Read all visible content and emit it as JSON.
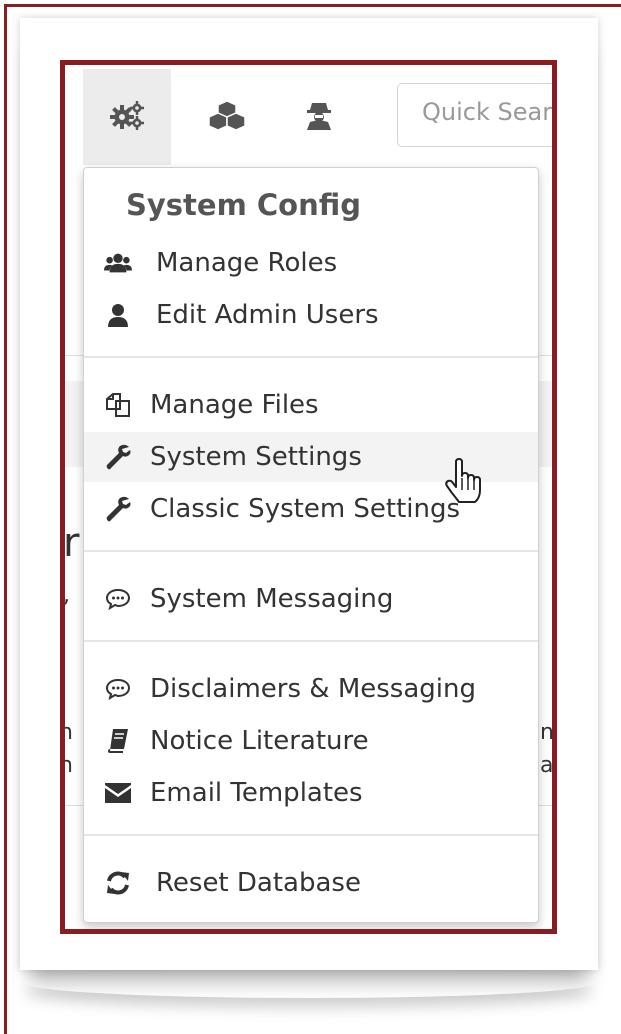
{
  "toolbar": {
    "search_placeholder": "Quick Search",
    "icons": [
      "gears-icon",
      "cubes-icon",
      "user-secret-icon"
    ]
  },
  "background": {
    "partial_left": [
      "r",
      ",",
      "n",
      "n"
    ],
    "partial_right": [
      "n",
      "a"
    ]
  },
  "menu": {
    "header": "System Config",
    "items": [
      {
        "label": "Manage Roles",
        "icon": "users-icon"
      },
      {
        "label": "Edit Admin Users",
        "icon": "user-icon"
      },
      {
        "label": "Manage Files",
        "icon": "files-icon"
      },
      {
        "label": "System Settings",
        "icon": "wrench-icon"
      },
      {
        "label": "Classic System Settings",
        "icon": "wrench-icon"
      },
      {
        "label": "System Messaging",
        "icon": "comment-icon"
      },
      {
        "label": "Disclaimers & Messaging",
        "icon": "comment-icon"
      },
      {
        "label": "Notice Literature",
        "icon": "book-icon"
      },
      {
        "label": "Email Templates",
        "icon": "envelope-icon"
      },
      {
        "label": "Reset Database",
        "icon": "refresh-icon"
      }
    ]
  },
  "colors": {
    "highlight_border": "#8a1d22",
    "active_tab_bg": "#ececec",
    "hover_bg": "#f3f3f3"
  }
}
